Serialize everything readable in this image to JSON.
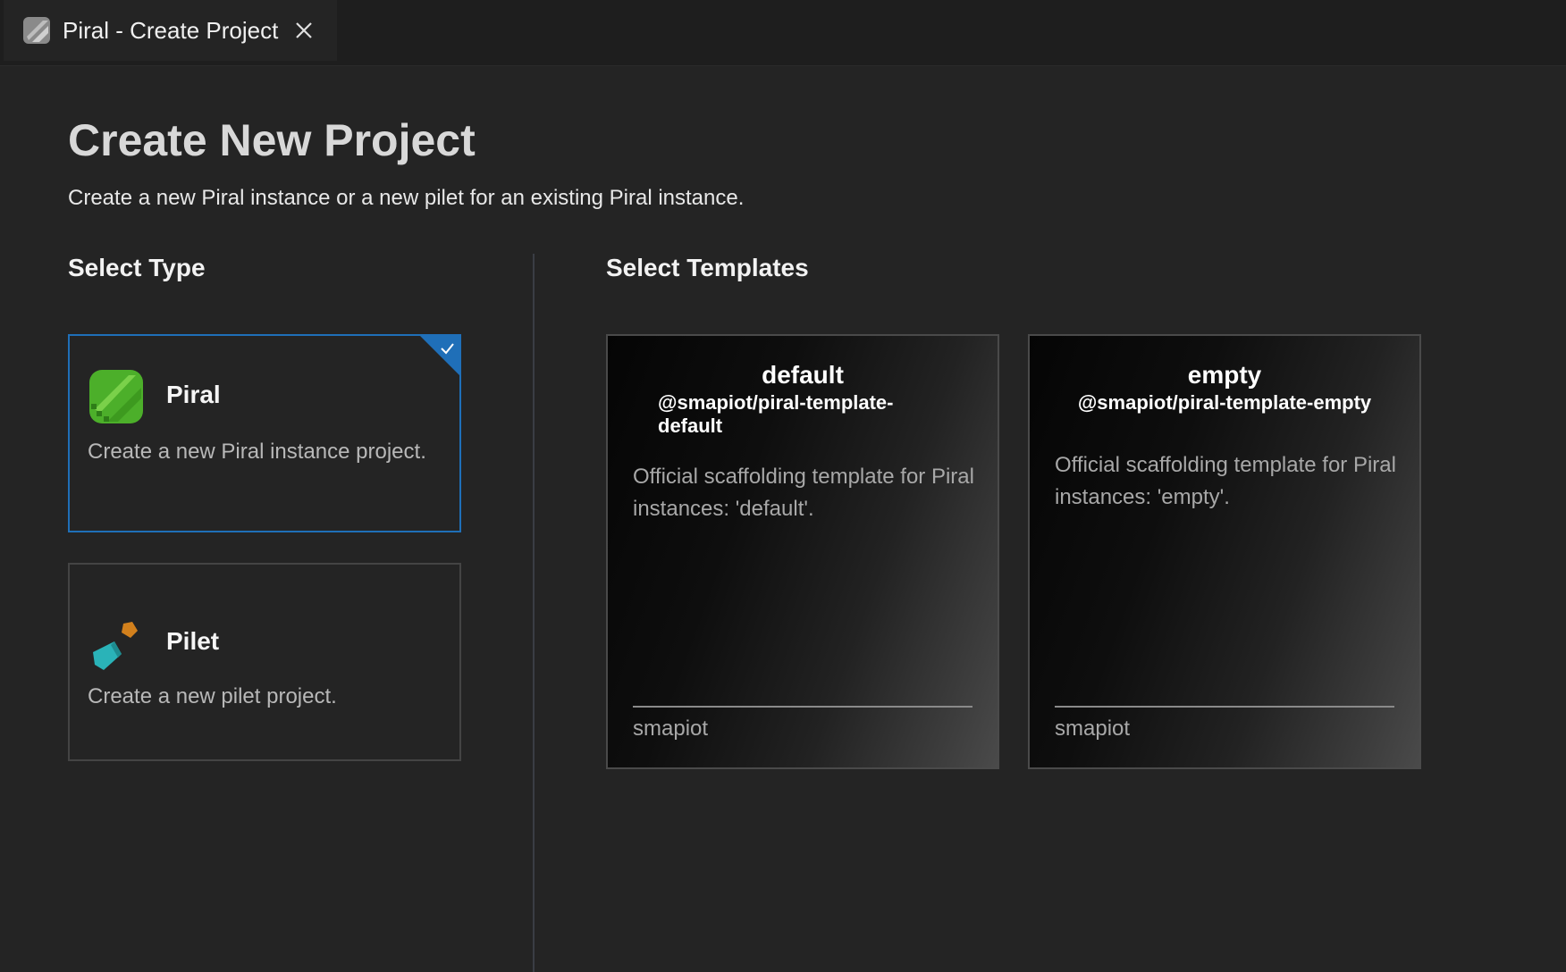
{
  "tab": {
    "title": "Piral - Create Project",
    "icon": "piral-logo-icon",
    "close_icon": "close-icon"
  },
  "header": {
    "title": "Create New Project",
    "subtitle": "Create a new Piral instance or a new pilet for an existing Piral instance."
  },
  "select_type": {
    "title": "Select Type",
    "options": [
      {
        "name": "Piral",
        "description": "Create a new Piral instance project.",
        "icon": "piral-logo-icon",
        "selected": true
      },
      {
        "name": "Pilet",
        "description": "Create a new pilet project.",
        "icon": "pilet-logo-icon",
        "selected": false
      }
    ]
  },
  "select_templates": {
    "title": "Select Templates",
    "templates": [
      {
        "name": "default",
        "package": "@smapiot/piral-template-default",
        "description": "Official scaffolding template for Piral instances: 'default'.",
        "author": "smapiot"
      },
      {
        "name": "empty",
        "package": "@smapiot/piral-template-empty",
        "description": "Official scaffolding template for Piral instances: 'empty'.",
        "author": "smapiot"
      }
    ]
  },
  "colors": {
    "background": "#242424",
    "titlebar": "#1e1e1e",
    "selected_border": "#1f6fb8",
    "piral_green": "#4caf2a",
    "pilet_teal": "#2ab3b8",
    "pilet_orange": "#d2801c"
  }
}
